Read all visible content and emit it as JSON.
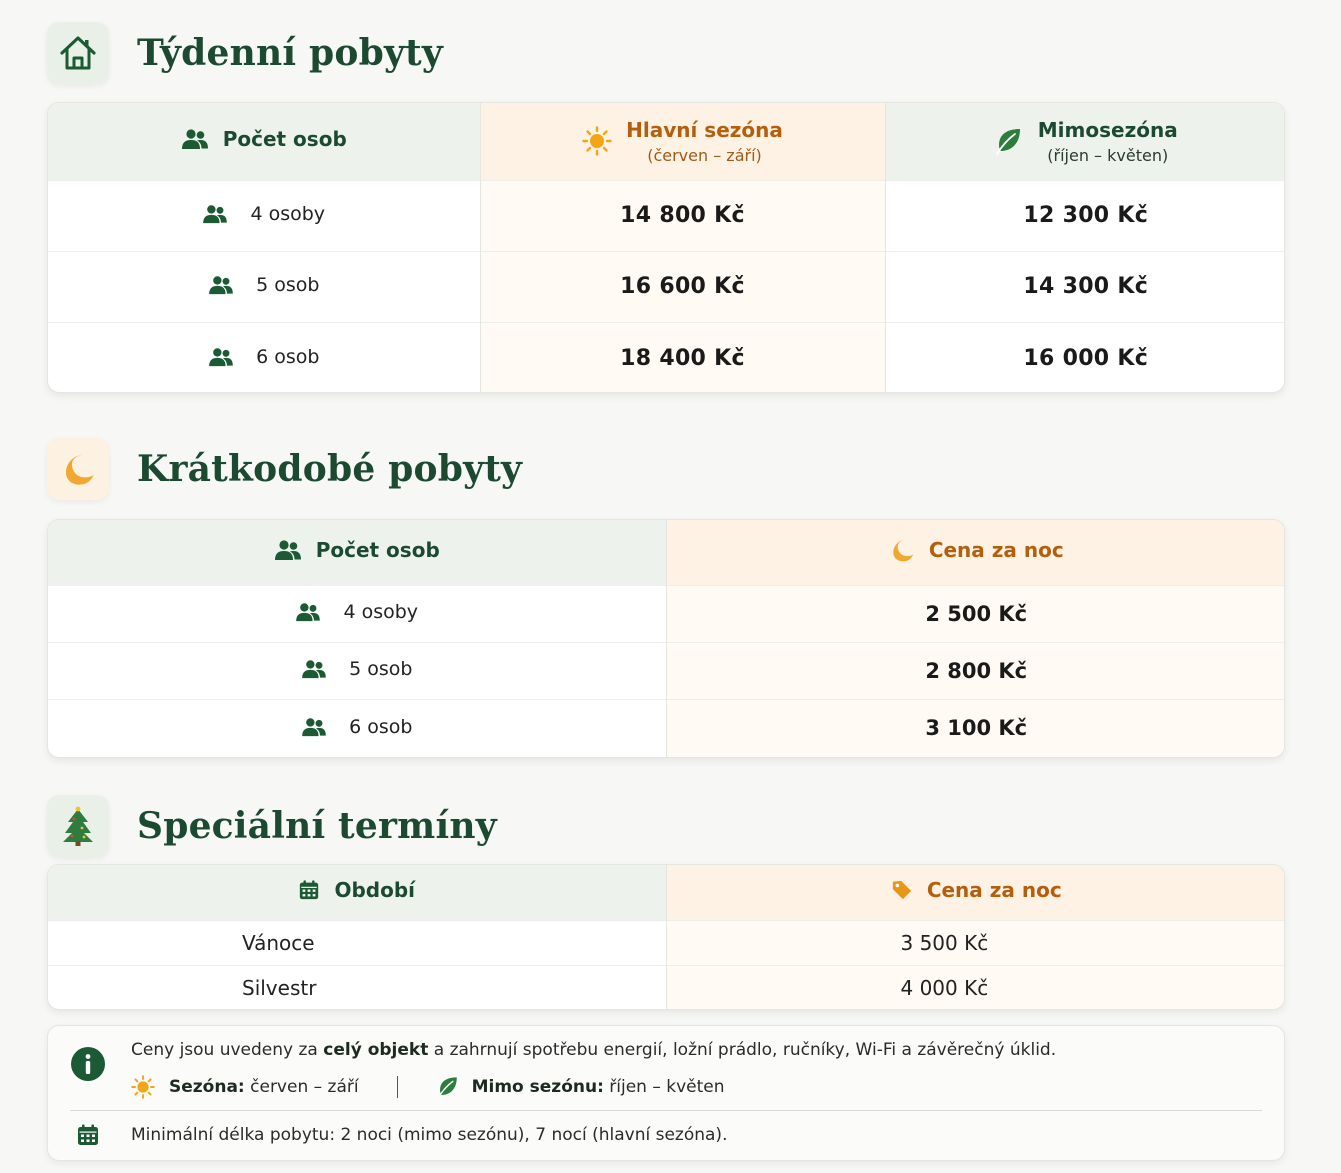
{
  "weekly": {
    "title": "Týdenní pobyty",
    "col_persons": "Počet osob",
    "col_main": "Hlavní sezóna",
    "col_main_sub": "(červen – září)",
    "col_off": "Mimosezóna",
    "col_off_sub": "(říjen – květen)",
    "rows": [
      {
        "persons": "4 osoby",
        "main": "14 800 Kč",
        "off": "12 300 Kč"
      },
      {
        "persons": "5 osob",
        "main": "16 600 Kč",
        "off": "14 300 Kč"
      },
      {
        "persons": "6 osob",
        "main": "18 400 Kč",
        "off": "16 000 Kč"
      }
    ]
  },
  "short": {
    "title": "Krátkodobé pobyty",
    "col_persons": "Počet osob",
    "col_price": "Cena za noc",
    "rows": [
      {
        "persons": "4 osoby",
        "price": "2 500 Kč"
      },
      {
        "persons": "5 osob",
        "price": "2 800 Kč"
      },
      {
        "persons": "6 osob",
        "price": "3 100 Kč"
      }
    ]
  },
  "special": {
    "title": "Speciální termíny",
    "col_period": "Období",
    "col_price": "Cena za noc",
    "rows": [
      {
        "period": "Vánoce",
        "price": "3 500 Kč"
      },
      {
        "period": "Silvestr",
        "price": "4 000 Kč"
      }
    ]
  },
  "info": {
    "line1_pre": "Ceny jsou uvedeny za ",
    "line1_bold": "celý objekt",
    "line1_post": " a zahrnují spotřebu energií, ložní prádlo, ručníky, Wi-Fi a závěrečný úklid.",
    "season_label": "Sezóna:",
    "season_value": " červen – září",
    "off_label": "Mimo sezónu:",
    "off_value": " říjen – květen",
    "min_stay": "Minimální délka pobytu: 2 noci (mimo sezónu), 7 nocí (hlavní sezóna)."
  },
  "colors": {
    "green": "#1c4a30",
    "orange": "#b35f0e",
    "sun": "#f2a516",
    "moon": "#f0a830"
  }
}
